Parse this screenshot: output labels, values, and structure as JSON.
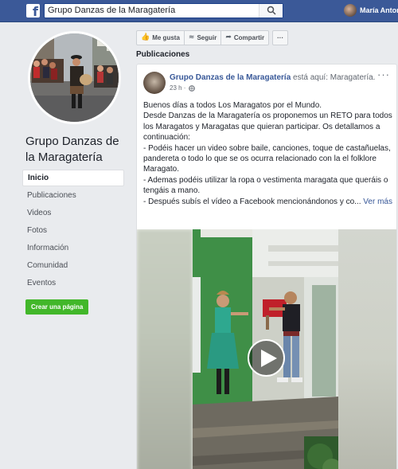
{
  "topbar": {
    "logo": "f",
    "search_value": "Grupo Danzas de la Maragatería",
    "user_name": "María Anton"
  },
  "sidebar": {
    "page_name": "Grupo Danzas de la Maragatería",
    "items": [
      {
        "label": "Inicio"
      },
      {
        "label": "Publicaciones"
      },
      {
        "label": "Videos"
      },
      {
        "label": "Fotos"
      },
      {
        "label": "Información"
      },
      {
        "label": "Comunidad"
      },
      {
        "label": "Eventos"
      }
    ],
    "create_page_label": "Crear una página"
  },
  "actions": {
    "like_label": "Me gusta",
    "follow_label": "Seguir",
    "share_label": "Compartir",
    "more_label": "···"
  },
  "feed": {
    "section_title": "Publicaciones"
  },
  "post": {
    "author": "Grupo Danzas de la Maragatería",
    "location_text": " está aquí: Maragatería.",
    "time": "23 h ·",
    "more": "···",
    "paragraphs": [
      "Buenos días a todos Los Maragatos por el Mundo.",
      "Desde Danzas de la Maragatería os proponemos un RETO para todos los Maragatos y Maragatas que quieran participar. Os detallamos a continuación:",
      "- Podéis hacer un video sobre baile, canciones, toque de castañuelas, pandereta o todo lo que se os ocurra relacionado con la el folklore Maragato.",
      "- Ademas podéis utilizar la ropa o vestimenta maragata que queráis o tengáis a mano.",
      "- Después subís el vídeo a Facebook mencionándonos y co..."
    ],
    "see_more": " Ver más"
  },
  "colors": {
    "brand": "#3b5998",
    "link": "#385898",
    "create_button": "#42b72a"
  }
}
